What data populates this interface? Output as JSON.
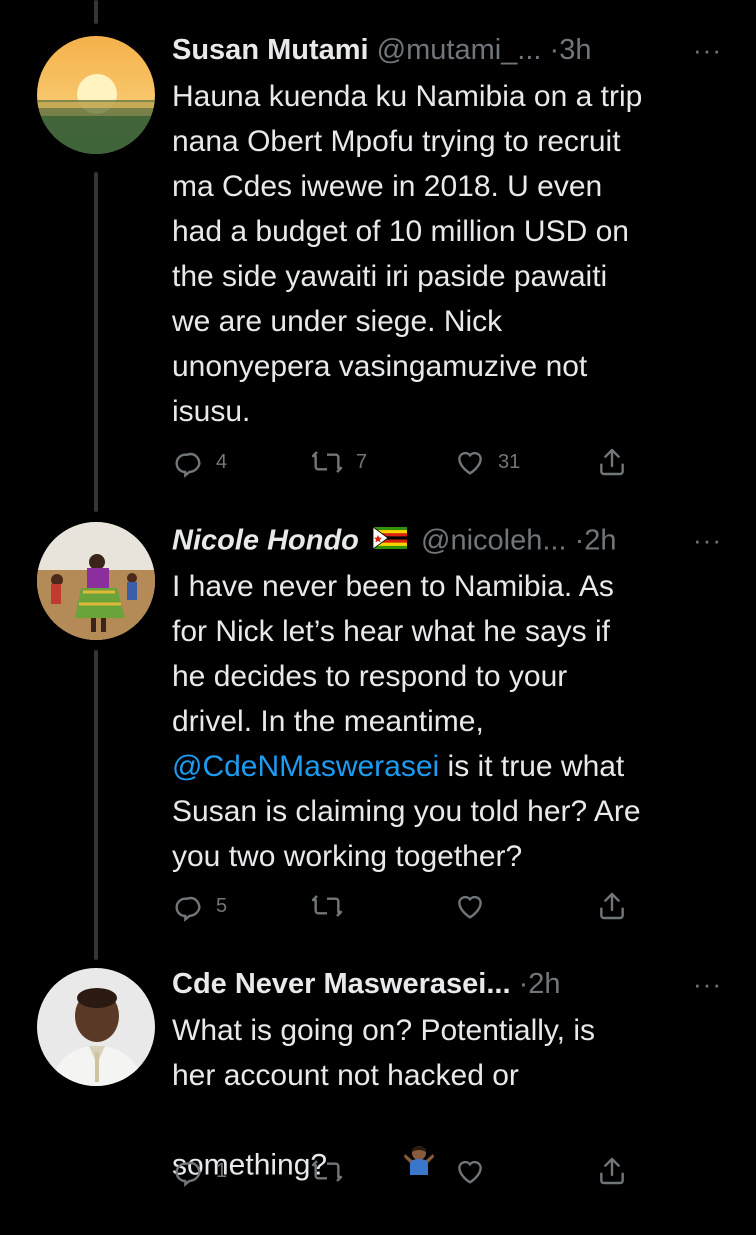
{
  "tweets": [
    {
      "name": "Susan Mutami",
      "handle": "@mutami_...",
      "time": "3h",
      "separator": "·",
      "more": "···",
      "text": "Hauna kuenda ku Namibia on a trip\nnana Obert Mpofu trying to recruit\nma Cdes iwewe in 2018. U even\nhad a budget of 10 million USD on\nthe side yawaiti iri paside pawaiti\nwe are under siege. Nick\nunonyepera vasingamuzive not\nisusu.",
      "replies": "4",
      "retweets": "7",
      "likes": "31"
    },
    {
      "name": "Nicole Hondo",
      "handle": "@nicoleh...",
      "time": "2h",
      "separator": "·",
      "more": "···",
      "text_before": "I have never been to Namibia. As\nfor Nick let’s hear what he says if\nhe decides to respond to your\ndrivel. In the meantime,\n",
      "mention": "@CdeNMaswerasei",
      "text_after": " is it true what\nSusan is claiming you told her? Are\nyou two working together?",
      "replies": "5",
      "retweets": "",
      "likes": ""
    },
    {
      "name": "Cde Never Maswerasei...",
      "handle": "",
      "time": "2h",
      "separator": "·",
      "more": "···",
      "text": "What is going on? Potentially, is\nher account not hacked or\nsomething? ",
      "replies": "1",
      "retweets": "",
      "likes": ""
    }
  ],
  "icons": {
    "reply": "reply-icon",
    "retweet": "retweet-icon",
    "like": "heart-icon",
    "share": "share-icon",
    "flag": "zimbabwe-flag-icon",
    "shrug": "person-shrugging-icon"
  },
  "colors": {
    "background": "#000000",
    "text": "#e7e9ea",
    "secondary": "#71767b",
    "link": "#1d9bf0",
    "thread_line": "#333639"
  }
}
